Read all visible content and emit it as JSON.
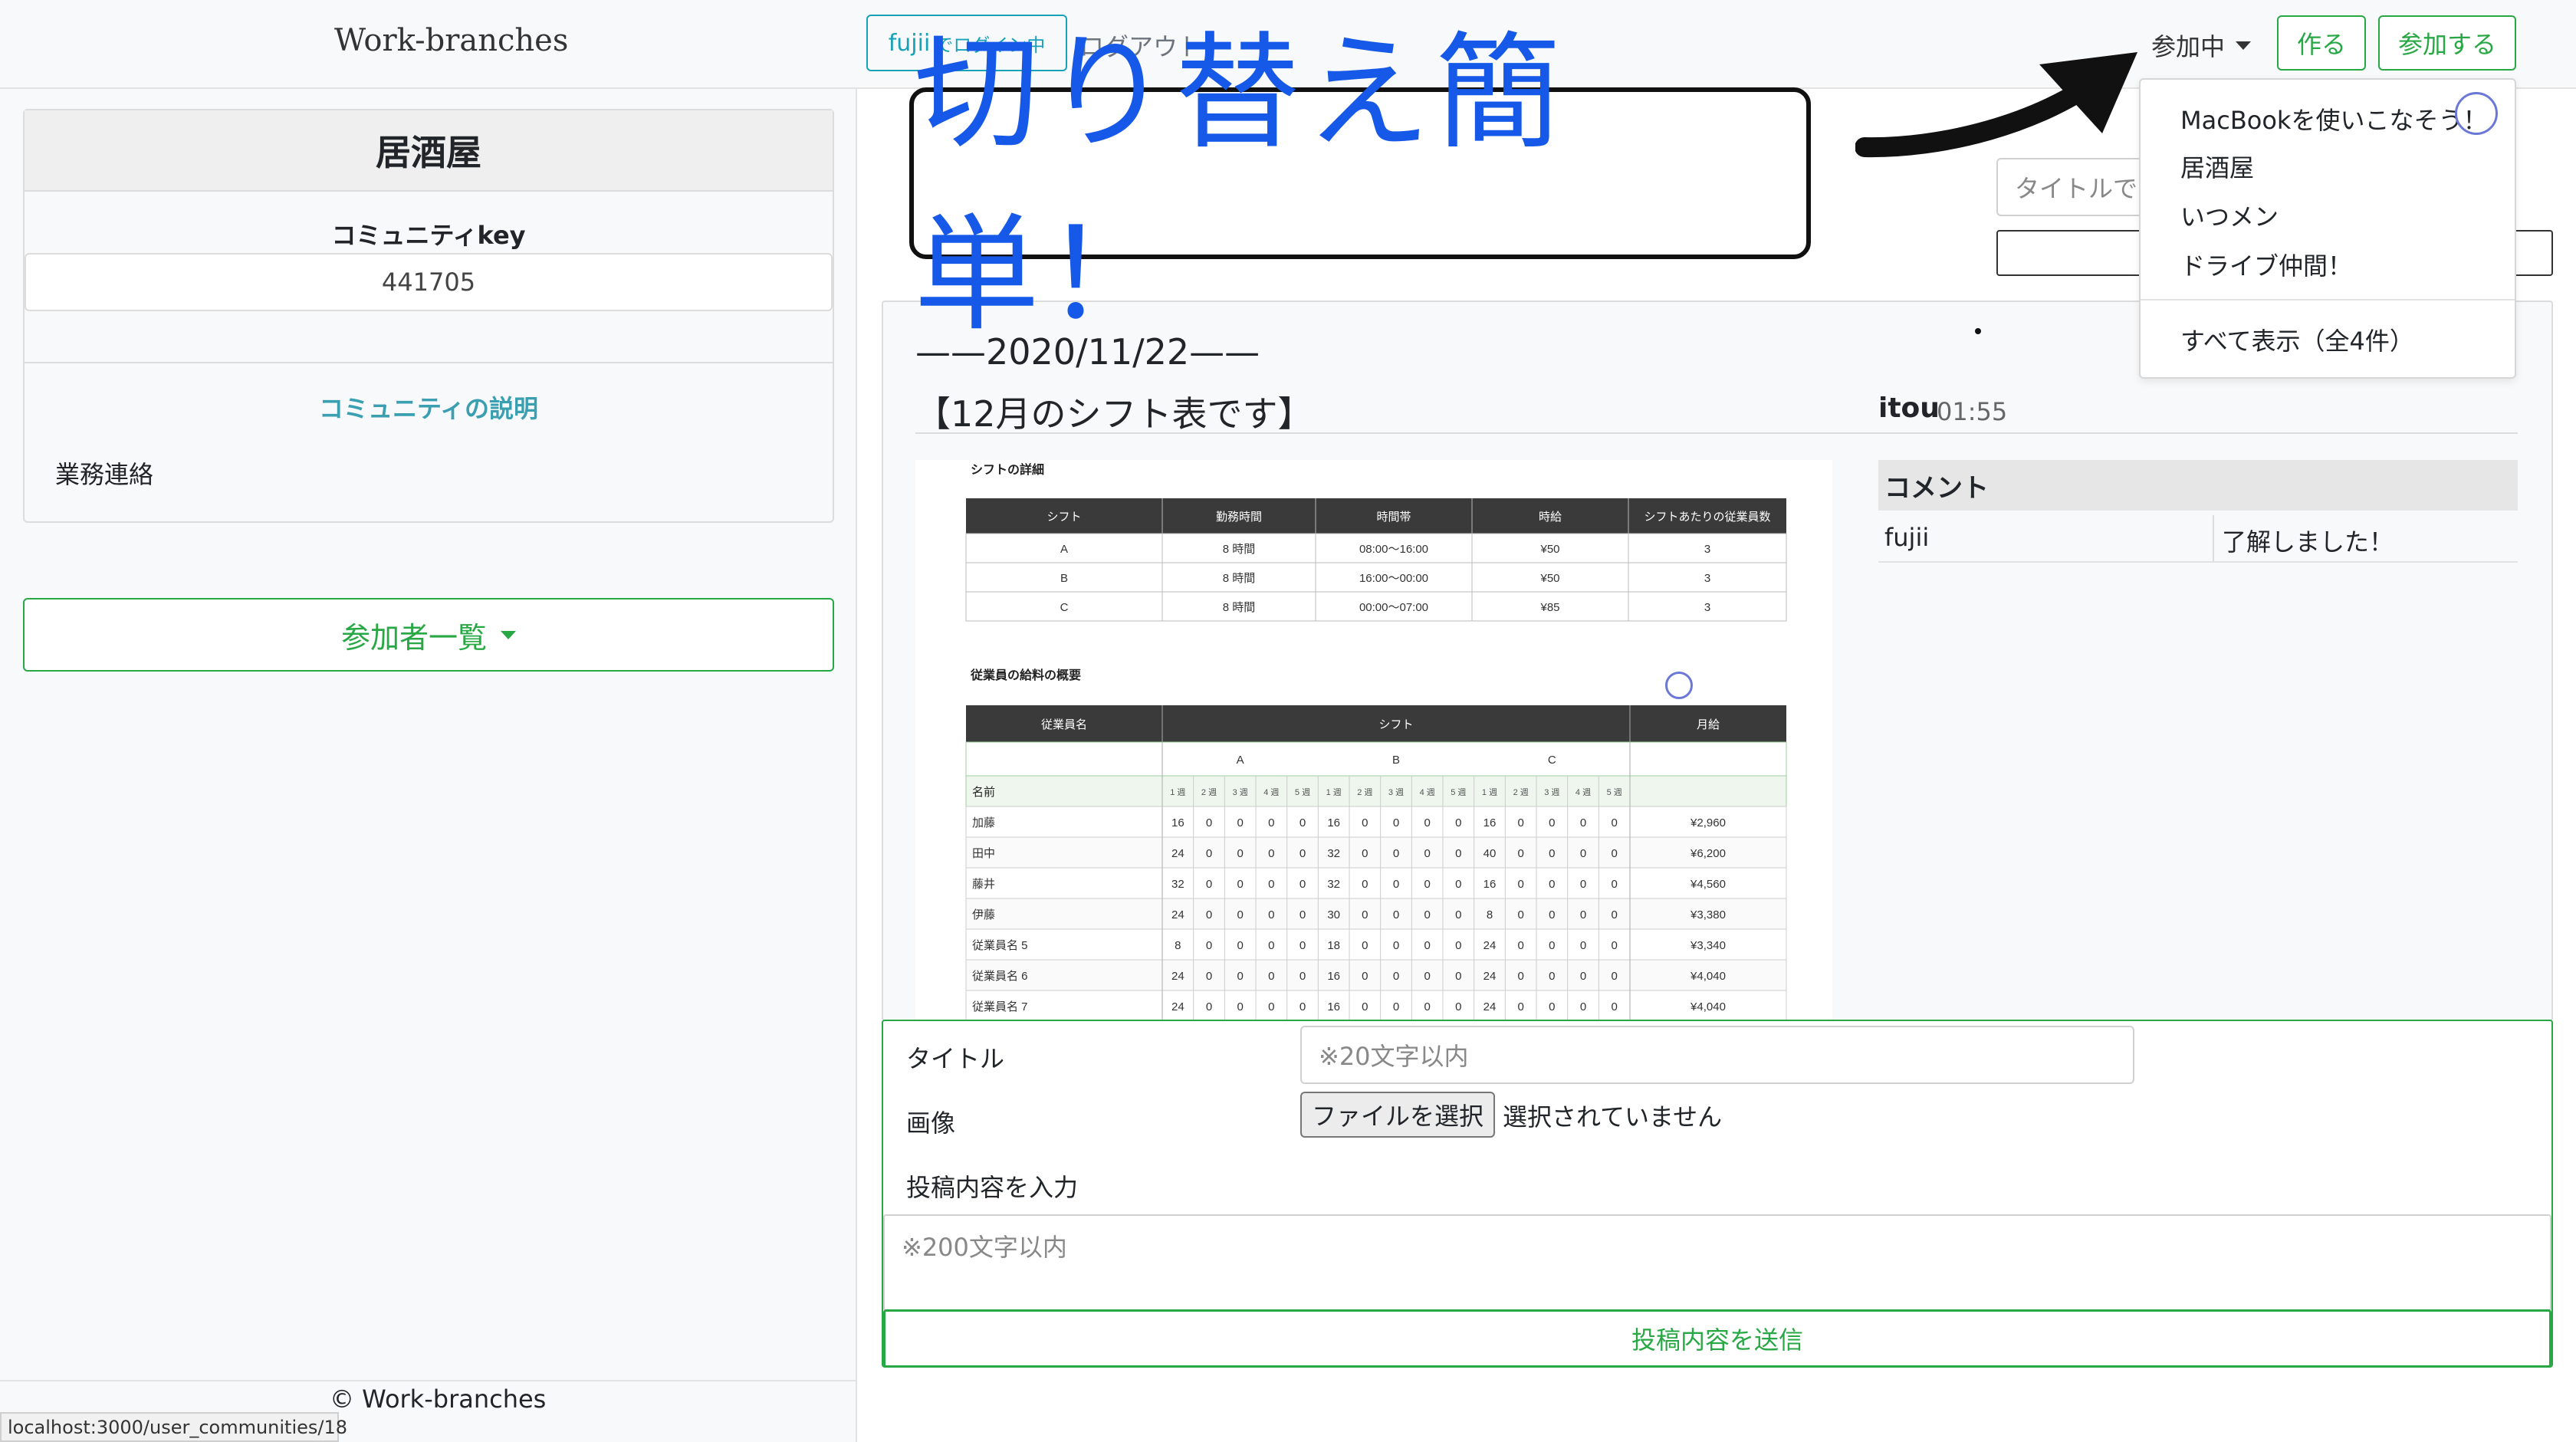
{
  "header": {
    "brand": "Work-branches",
    "login_user": "fujii",
    "login_suffix": "でログイン中",
    "logout": "ログアウト",
    "joined_menu": "参加中",
    "create_button": "作る",
    "join_button": "参加する"
  },
  "dropdown": {
    "items": [
      "MacBookを使いこなそう！",
      "居酒屋",
      "いつメン",
      "ドライブ仲間！"
    ],
    "show_all": "すべて表示（全4件）"
  },
  "sidebar": {
    "community_name": "居酒屋",
    "key_label": "コミュニティkey",
    "key_value": "441705",
    "description_label": "コミュニティの説明",
    "description_value": "業務連絡",
    "members_button": "参加者一覧",
    "footer": "© Work-branches",
    "status_url": "localhost:3000/user_communities/18"
  },
  "annotation": {
    "text": "切り替え簡単！"
  },
  "search": {
    "placeholder": "タイトルで"
  },
  "post": {
    "date": "——2020/11/22——",
    "title": "【12月のシフト表です】",
    "author": "itou",
    "time": "01:55",
    "image": {
      "section1_title": "シフトの詳細",
      "shift_headers": [
        "シフト",
        "勤務時間",
        "時間帯",
        "時給",
        "シフトあたりの従業員数"
      ],
      "shift_rows": [
        [
          "A",
          "8 時間",
          "08:00〜16:00",
          "¥50",
          "3"
        ],
        [
          "B",
          "8 時間",
          "16:00〜00:00",
          "¥50",
          "3"
        ],
        [
          "C",
          "8 時間",
          "00:00〜07:00",
          "¥85",
          "3"
        ]
      ],
      "section2_title": "従業員の給料の概要",
      "pay_headers": [
        "従業員名",
        "シフト",
        "月給"
      ],
      "shift_groups": [
        "A",
        "B",
        "C"
      ],
      "week_labels": [
        "1 週",
        "2 週",
        "3 週",
        "4 週",
        "5 週"
      ],
      "name_header": "名前",
      "pay_rows": [
        {
          "name": "加藤",
          "hours": [
            "16",
            "0",
            "0",
            "0",
            "0",
            "16",
            "0",
            "0",
            "0",
            "0",
            "16",
            "0",
            "0",
            "0",
            "0"
          ],
          "salary": "¥2,960"
        },
        {
          "name": "田中",
          "hours": [
            "24",
            "0",
            "0",
            "0",
            "0",
            "32",
            "0",
            "0",
            "0",
            "0",
            "40",
            "0",
            "0",
            "0",
            "0"
          ],
          "salary": "¥6,200"
        },
        {
          "name": "藤井",
          "hours": [
            "32",
            "0",
            "0",
            "0",
            "0",
            "32",
            "0",
            "0",
            "0",
            "0",
            "16",
            "0",
            "0",
            "0",
            "0"
          ],
          "salary": "¥4,560"
        },
        {
          "name": "伊藤",
          "hours": [
            "24",
            "0",
            "0",
            "0",
            "0",
            "30",
            "0",
            "0",
            "0",
            "0",
            "8",
            "0",
            "0",
            "0",
            "0"
          ],
          "salary": "¥3,380"
        },
        {
          "name": "従業員名 5",
          "hours": [
            "8",
            "0",
            "0",
            "0",
            "0",
            "18",
            "0",
            "0",
            "0",
            "0",
            "24",
            "0",
            "0",
            "0",
            "0"
          ],
          "salary": "¥3,340"
        },
        {
          "name": "従業員名 6",
          "hours": [
            "24",
            "0",
            "0",
            "0",
            "0",
            "16",
            "0",
            "0",
            "0",
            "0",
            "24",
            "0",
            "0",
            "0",
            "0"
          ],
          "salary": "¥4,040"
        },
        {
          "name": "従業員名 7",
          "hours": [
            "24",
            "0",
            "0",
            "0",
            "0",
            "16",
            "0",
            "0",
            "0",
            "0",
            "24",
            "0",
            "0",
            "0",
            "0"
          ],
          "salary": "¥4,040"
        }
      ]
    }
  },
  "comments": {
    "header": "コメント",
    "items": [
      {
        "user": "fujii",
        "text": "了解しました！"
      }
    ]
  },
  "form": {
    "title_label": "タイトル",
    "title_placeholder": "※20文字以内",
    "image_label": "画像",
    "file_button": "ファイルを選択",
    "file_status": "選択されていません",
    "body_label": "投稿内容を入力",
    "body_placeholder": "※200文字以内",
    "submit": "投稿内容を送信"
  }
}
